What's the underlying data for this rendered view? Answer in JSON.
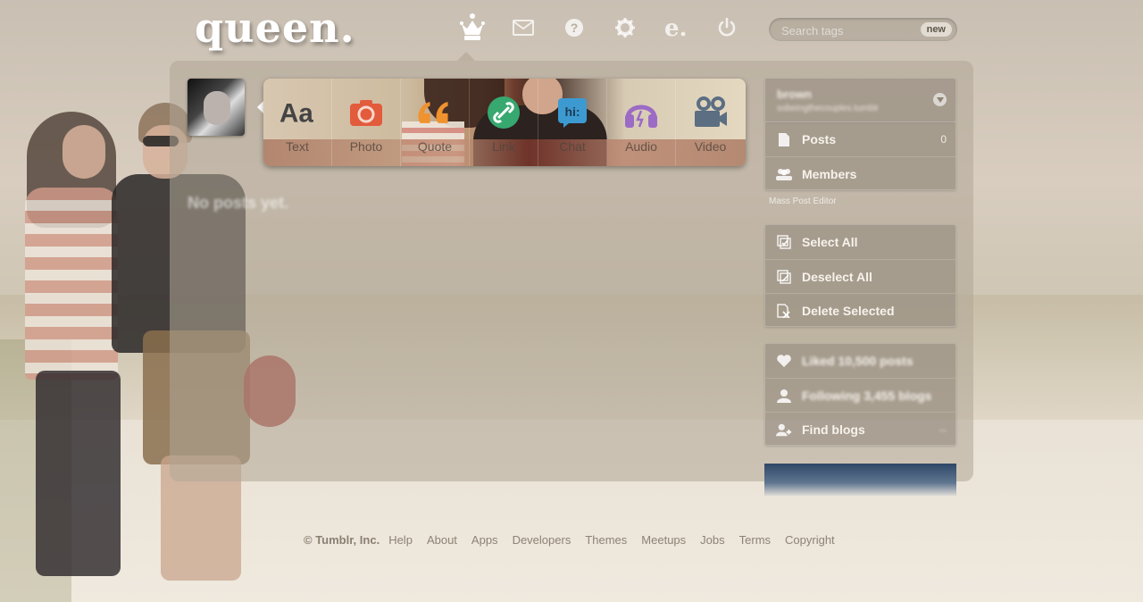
{
  "header": {
    "logo_text": "queen.",
    "nav_icons": [
      "crown-icon",
      "mail-icon",
      "help-icon",
      "settings-icon",
      "e-icon",
      "power-icon"
    ],
    "search_placeholder": "Search tags",
    "search_badge": "new"
  },
  "post_types": [
    {
      "label": "Text",
      "icon": "text-icon",
      "color": "#444444"
    },
    {
      "label": "Photo",
      "icon": "camera-icon",
      "color": "#e25b3c"
    },
    {
      "label": "Quote",
      "icon": "quote-icon",
      "color": "#f0922e"
    },
    {
      "label": "Link",
      "icon": "link-icon",
      "color": "#37a86f"
    },
    {
      "label": "Chat",
      "icon": "chat-icon",
      "color": "#3d9ad1"
    },
    {
      "label": "Audio",
      "icon": "headphones-icon",
      "color": "#9b6bc5"
    },
    {
      "label": "Video",
      "icon": "video-camera-icon",
      "color": "#5b6e82"
    }
  ],
  "main": {
    "empty_message": "No posts yet."
  },
  "sidebar": {
    "blog_name": "brown",
    "blog_url": "sobeingthecouples.tumblr",
    "posts_label": "Posts",
    "posts_count": "0",
    "members_label": "Members",
    "mass_editor_label": "Mass Post Editor",
    "select_all_label": "Select All",
    "deselect_all_label": "Deselect All",
    "delete_selected_label": "Delete Selected",
    "liked_label": "Liked 10,500 posts",
    "following_label": "Following 3,455 blogs",
    "find_blogs_label": "Find blogs",
    "find_blogs_count": "--"
  },
  "footer": {
    "copyright": "© Tumblr, Inc.",
    "links": [
      "Help",
      "About",
      "Apps",
      "Developers",
      "Themes",
      "Meetups",
      "Jobs",
      "Terms",
      "Copyright"
    ]
  }
}
